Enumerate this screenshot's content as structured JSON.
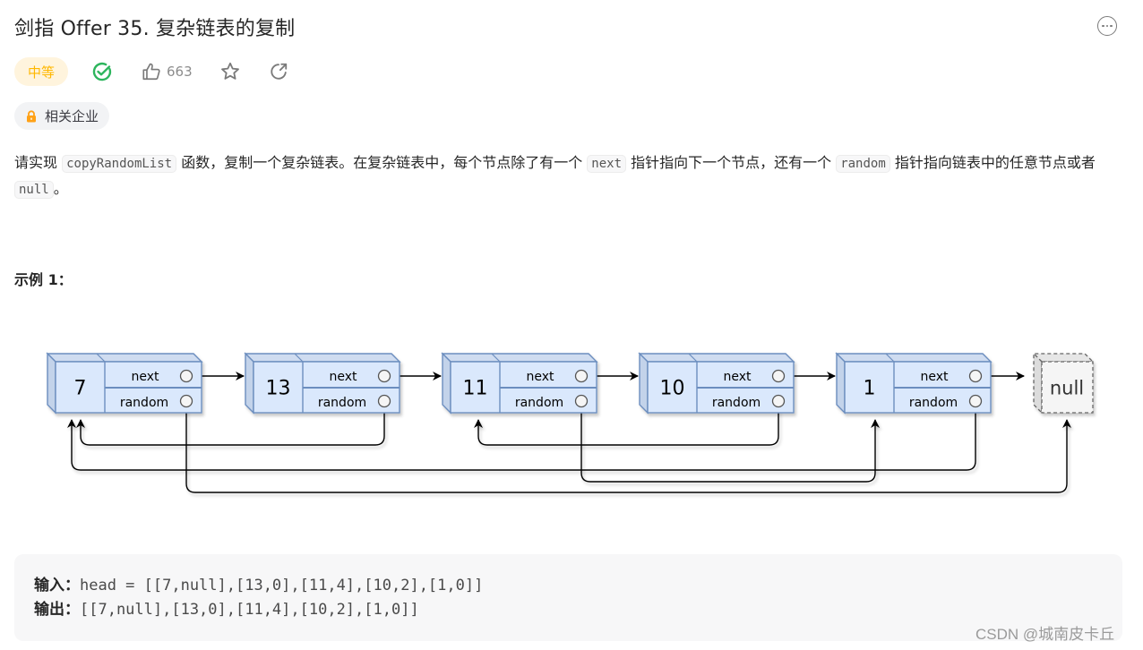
{
  "header": {
    "title": "剑指 Offer 35. 复杂链表的复制",
    "more_icon": "more-horizontal-circle-icon"
  },
  "meta": {
    "difficulty": "中等",
    "difficulty_color": "#ffb700",
    "solved_icon": "check-circle-icon",
    "solved_color": "#2db55d",
    "like_count": "663",
    "like_icon": "thumbs-up-icon",
    "star_icon": "star-icon",
    "share_icon": "share-icon"
  },
  "company_tag": {
    "icon": "lock-icon",
    "label": "相关企业",
    "icon_color": "#ffa116"
  },
  "description": {
    "p1_a": "请实现 ",
    "code1": "copyRandomList",
    "p1_b": " 函数，复制一个复杂链表。在复杂链表中，每个节点除了有一个 ",
    "code2": "next",
    "p1_c": " 指针指向下一个节点，还有一个 ",
    "code3": "random",
    "p1_d": " 指针指向链表中的任意节点或者 ",
    "code4": "null",
    "p1_e": "。"
  },
  "example": {
    "title": "示例 1：",
    "input_label": "输入：",
    "input_value": "head = [[7,null],[13,0],[11,4],[10,2],[1,0]]",
    "output_label": "输出：",
    "output_value": "[[7,null],[13,0],[11,4],[10,2],[1,0]]"
  },
  "diagram": {
    "next_label": "next",
    "random_label": "random",
    "null_label": "null",
    "node_fill": "#dae8fc",
    "node_stroke": "#6c8ebf",
    "nodes": [
      {
        "value": "7",
        "random_index": null
      },
      {
        "value": "13",
        "random_index": 0
      },
      {
        "value": "11",
        "random_index": 4
      },
      {
        "value": "10",
        "random_index": 2
      },
      {
        "value": "1",
        "random_index": 0
      }
    ]
  },
  "watermark": "CSDN @城南皮卡丘"
}
